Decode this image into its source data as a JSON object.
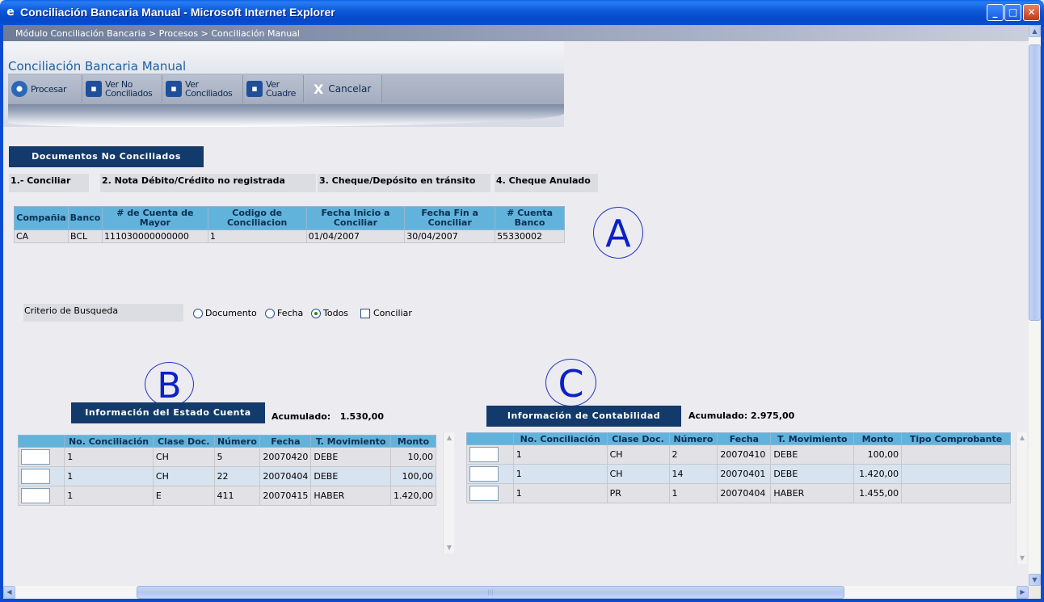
{
  "window": {
    "title": "Conciliación Bancaria Manual - Microsoft Internet Explorer",
    "minimize": "_",
    "maximize": "□",
    "close": "✕"
  },
  "breadcrumb": "Módulo Conciliación Bancaria > Procesos > Conciliación Manual",
  "page_title": "Conciliación Bancaria Manual",
  "toolbar": {
    "procesar": "Procesar",
    "ver_no_conciliados": [
      "Ver No",
      "Conciliados"
    ],
    "ver_conciliados": [
      "Ver",
      "Conciliados"
    ],
    "ver_cuadre": [
      "Ver",
      "Cuadre"
    ],
    "cancelar": "Cancelar",
    "cancelar_icon": "X"
  },
  "documentos_label": "Documentos No Conciliados",
  "options": [
    "1.- Conciliar",
    "2. Nota Débito/Crédito no registrada",
    "3. Cheque/Depósito en tránsito",
    "4. Cheque Anulado"
  ],
  "header_table": {
    "columns": [
      "Compañia",
      "Banco",
      "# de Cuenta de Mayor",
      "Codigo de Conciliacion",
      "Fecha Inicio a Conciliar",
      "Fecha Fin a Conciliar",
      "# Cuenta Banco"
    ],
    "row": [
      "CA",
      "BCL",
      "111030000000000",
      "1",
      "01/04/2007",
      "30/04/2007",
      "55330002"
    ]
  },
  "annotations": {
    "a": "A",
    "b": "B",
    "c": "C"
  },
  "criterio": {
    "label": "Criterio de Busqueda",
    "documento": "Documento",
    "fecha": "Fecha",
    "todos": "Todos",
    "conciliar": "Conciliar",
    "selected": "Todos"
  },
  "estado_cuenta": {
    "label": "Información del Estado Cuenta",
    "acumulado_label": "Acumulado:",
    "acumulado_value": "1.530,00",
    "columns": [
      "",
      "No. Conciliación",
      "Clase Doc.",
      "Número",
      "Fecha",
      "T. Movimiento",
      "Monto"
    ],
    "rows": [
      [
        "1",
        "CH",
        "5",
        "20070420",
        "DEBE",
        "10,00"
      ],
      [
        "1",
        "CH",
        "22",
        "20070404",
        "DEBE",
        "100,00"
      ],
      [
        "1",
        "E",
        "411",
        "20070415",
        "HABER",
        "1.420,00"
      ]
    ]
  },
  "contabilidad": {
    "label": "Información de Contabilidad",
    "acumulado_label": "Acumulado:",
    "acumulado_value": "2.975,00",
    "columns": [
      "",
      "No. Conciliación",
      "Clase Doc.",
      "Número",
      "Fecha",
      "T. Movimiento",
      "Monto",
      "Tipo Comprobante"
    ],
    "rows": [
      [
        "1",
        "CH",
        "2",
        "20070410",
        "DEBE",
        "100,00",
        ""
      ],
      [
        "1",
        "CH",
        "14",
        "20070401",
        "DEBE",
        "1.420,00",
        ""
      ],
      [
        "1",
        "PR",
        "1",
        "20070404",
        "HABER",
        "1.455,00",
        ""
      ]
    ]
  },
  "scroll": {
    "up": "▲",
    "down": "▼",
    "left": "◀",
    "right": "▶",
    "grip": "|||"
  }
}
